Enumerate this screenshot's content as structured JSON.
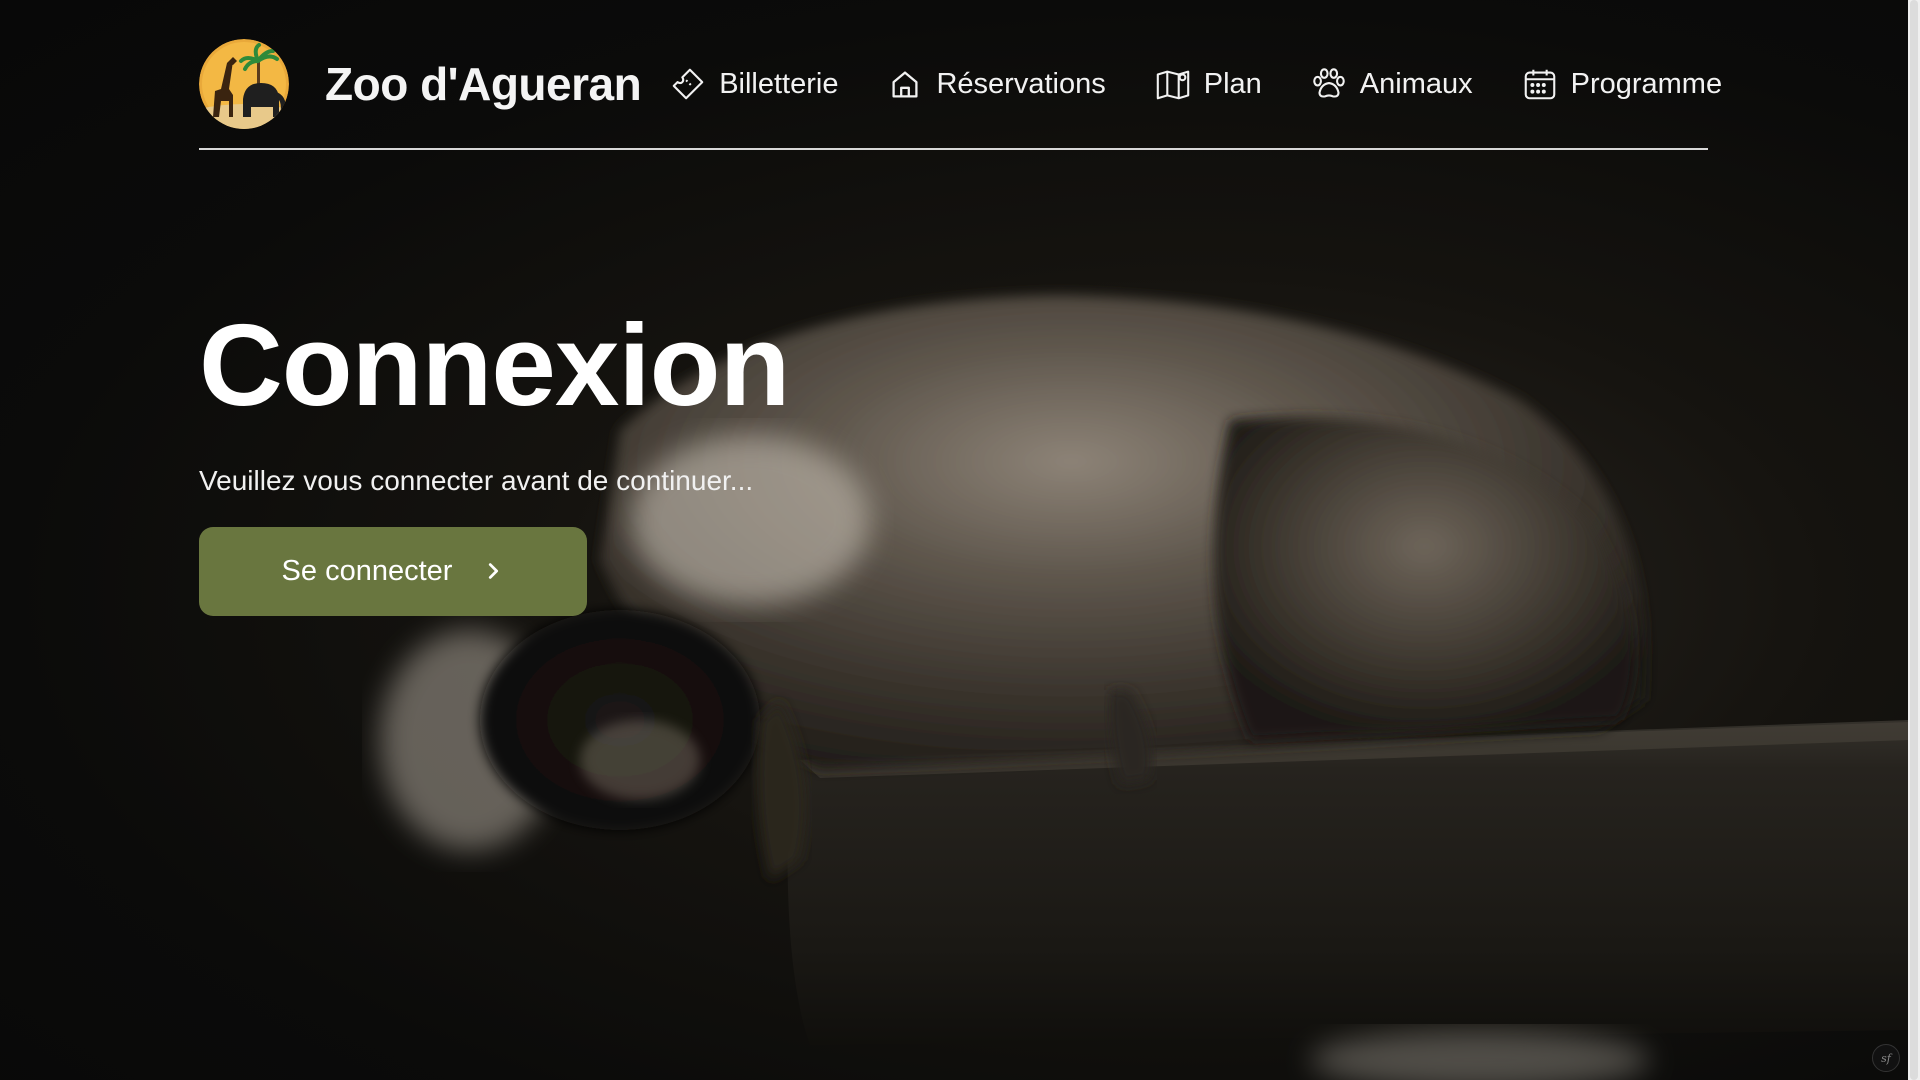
{
  "header": {
    "brand_name": "Zoo d'Agueran",
    "logo_icon": "zoo-logo-giraffe-elephant-palm",
    "nav": [
      {
        "label": "Billetterie",
        "icon": "ticket-icon"
      },
      {
        "label": "Réservations",
        "icon": "home-icon"
      },
      {
        "label": "Plan",
        "icon": "map-icon"
      },
      {
        "label": "Animaux",
        "icon": "paw-icon"
      },
      {
        "label": "Programme",
        "icon": "calendar-icon"
      }
    ]
  },
  "hero": {
    "title": "Connexion",
    "subtitle": "Veuillez vous connecter avant de continuer...",
    "button_label": "Se connecter",
    "button_icon": "chevron-right-icon"
  },
  "colors": {
    "background": "#0b0b0b",
    "button": "#69763f",
    "text": "#ffffff",
    "divider": "#d8d8d8"
  }
}
